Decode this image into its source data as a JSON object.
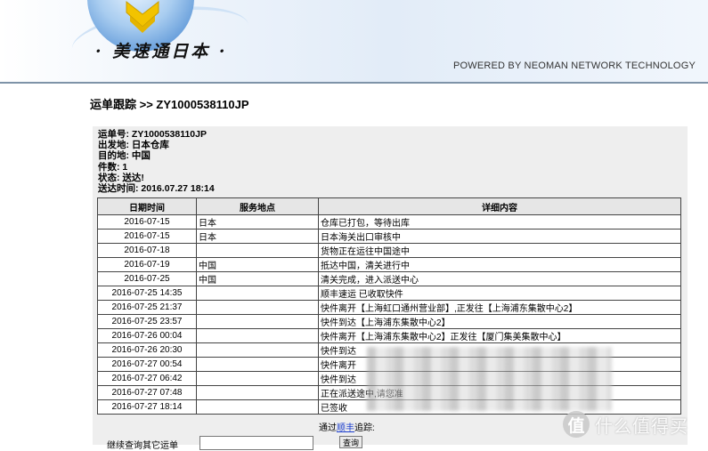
{
  "header": {
    "brand": "· 美速通日本 ·",
    "powered_by": "POWERED BY NEOMAN NETWORK TECHNOLOGY"
  },
  "page_title": "运单跟踪 >> ZY1000538110JP",
  "info": {
    "waybill": "运单号: ZY1000538110JP",
    "origin": "出发地: 日本仓库",
    "destination": "目的地: 中国",
    "pieces": "件数: 1",
    "status": "状态: 送达!",
    "delivered_time": "送达时间: 2016.07.27 18:14"
  },
  "table": {
    "headers": [
      "日期时间",
      "服务地点",
      "详细内容"
    ],
    "rows": [
      {
        "date": "2016-07-15",
        "location": "日本",
        "detail": "仓库已打包，等待出库"
      },
      {
        "date": "2016-07-15",
        "location": "日本",
        "detail": "日本海关出口审核中"
      },
      {
        "date": "2016-07-18",
        "location": "",
        "detail": "货物正在运往中国途中"
      },
      {
        "date": "2016-07-19",
        "location": "中国",
        "detail": "抵达中国，清关进行中"
      },
      {
        "date": "2016-07-25",
        "location": "中国",
        "detail": "清关完成，进入派送中心"
      },
      {
        "date": "2016-07-25 14:35",
        "location": "",
        "detail": "顺丰速运 已收取快件"
      },
      {
        "date": "2016-07-25 21:37",
        "location": "",
        "detail": "快件离开【上海虹口通州营业部】,正发往【上海浦东集散中心2】"
      },
      {
        "date": "2016-07-25 23:57",
        "location": "",
        "detail": "快件到达【上海浦东集散中心2】"
      },
      {
        "date": "2016-07-26 00:04",
        "location": "",
        "detail": "快件离开【上海浦东集散中心2】正发往【厦门集美集散中心】"
      },
      {
        "date": "2016-07-26 20:30",
        "location": "",
        "detail": "快件到达"
      },
      {
        "date": "2016-07-27 00:54",
        "location": "",
        "detail": "快件离开"
      },
      {
        "date": "2016-07-27 06:42",
        "location": "",
        "detail": "快件到达"
      },
      {
        "date": "2016-07-27 07:48",
        "location": "",
        "detail": "正在派送途中,请您准"
      },
      {
        "date": "2016-07-27 18:14",
        "location": "",
        "detail": "已签收"
      }
    ]
  },
  "via": {
    "prefix": "通过",
    "carrier_link": "顺丰",
    "suffix": "追踪:"
  },
  "continue_query": {
    "label": "继续查询其它运单",
    "input_value": "",
    "button": "查询"
  },
  "watermark": {
    "badge": "值",
    "text": "什么值得买"
  },
  "colors": {
    "header_border": "#7e93a8",
    "panel_bg": "#eeeeee",
    "link": "#1a3ccc"
  }
}
